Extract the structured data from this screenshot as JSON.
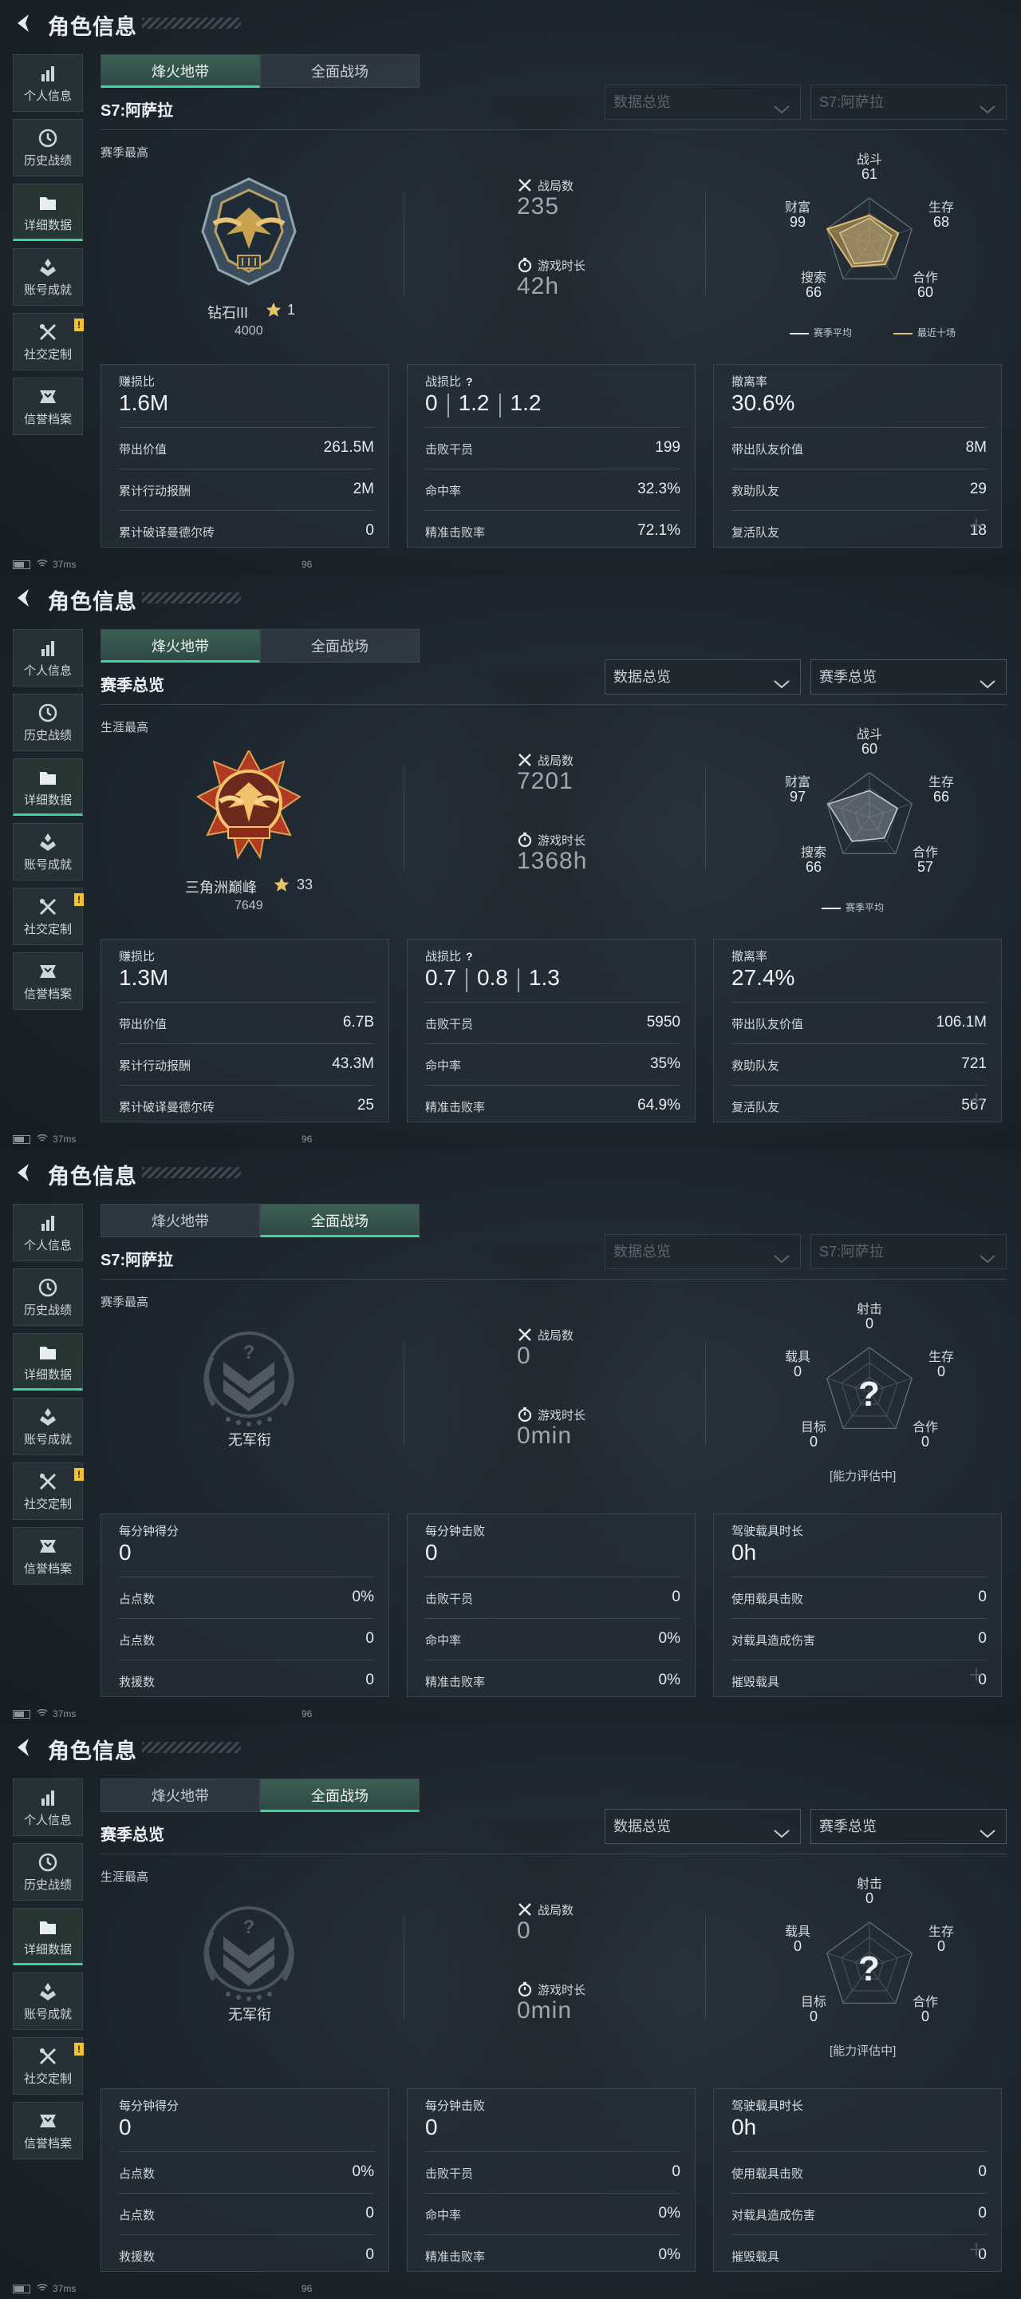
{
  "common": {
    "title": "角色信息",
    "sidebar": [
      "个人信息",
      "历史战绩",
      "详细数据",
      "账号成就",
      "社交定制",
      "信誉档案"
    ],
    "sidebar_active": 2,
    "sidebar_warn_index": 4,
    "warn_mark": "!",
    "tabs": [
      "烽火地带",
      "全面战场"
    ],
    "status_ping": "37ms",
    "status_num": "96",
    "accent": "#38d39a"
  },
  "panels": [
    {
      "active_tab": 0,
      "season": "S7:阿萨拉",
      "dropdowns": [
        {
          "label": "数据总览",
          "dim": true
        },
        {
          "label": "S7:阿萨拉",
          "dim": true
        }
      ],
      "section_label": "赛季最高",
      "rank_emblem": "diamond-emblem",
      "rank_name": "钻石III",
      "rank_level": "1",
      "rank_score": "4000",
      "stat1": {
        "label": "战局数",
        "value": "235"
      },
      "stat2": {
        "label": "游戏时长",
        "value": "42h"
      },
      "radar": {
        "type": "colored",
        "labels": [
          "战斗",
          "生存",
          "合作",
          "搜索",
          "财富"
        ],
        "values": [
          "61",
          "68",
          "60",
          "66",
          "99"
        ],
        "shape": [
          0.61,
          0.68,
          0.6,
          0.66,
          0.99
        ],
        "shape2": [
          0.55,
          0.52,
          0.5,
          0.58,
          0.7
        ],
        "legend": [
          "赛季平均",
          "最近十场"
        ],
        "placeholder": ""
      },
      "cards": [
        {
          "header": "赚损比",
          "value": "1.6M",
          "rows": [
            [
              "带出价值",
              "261.5M"
            ],
            [
              "累计行动报酬",
              "2M"
            ],
            [
              "累计破译曼德尔砖",
              "0"
            ]
          ]
        },
        {
          "header": "战损比",
          "kd": [
            "0",
            "1.2",
            "1.2"
          ],
          "q": "?",
          "rows": [
            [
              "击败干员",
              "199"
            ],
            [
              "命中率",
              "32.3%"
            ],
            [
              "精准击败率",
              "72.1%"
            ]
          ]
        },
        {
          "header": "撤离率",
          "value": "30.6%",
          "rows": [
            [
              "带出队友价值",
              "8M"
            ],
            [
              "救助队友",
              "29"
            ],
            [
              "复活队友",
              "18"
            ]
          ]
        }
      ]
    },
    {
      "active_tab": 0,
      "season": "赛季总览",
      "dropdowns": [
        {
          "label": "数据总览",
          "dim": false
        },
        {
          "label": "赛季总览",
          "dim": false
        }
      ],
      "section_label": "生涯最高",
      "rank_emblem": "peak-emblem",
      "rank_name": "三角洲巅峰",
      "rank_level": "33",
      "rank_score": "7649",
      "stat1": {
        "label": "战局数",
        "value": "7201"
      },
      "stat2": {
        "label": "游戏时长",
        "value": "1368h"
      },
      "radar": {
        "type": "gray",
        "labels": [
          "战斗",
          "生存",
          "合作",
          "搜索",
          "财富"
        ],
        "values": [
          "60",
          "66",
          "57",
          "66",
          "97"
        ],
        "shape": [
          0.6,
          0.66,
          0.57,
          0.66,
          0.97
        ],
        "legend": [
          "赛季平均"
        ],
        "placeholder": ""
      },
      "cards": [
        {
          "header": "赚损比",
          "value": "1.3M",
          "rows": [
            [
              "带出价值",
              "6.7B"
            ],
            [
              "累计行动报酬",
              "43.3M"
            ],
            [
              "累计破译曼德尔砖",
              "25"
            ]
          ]
        },
        {
          "header": "战损比",
          "kd": [
            "0.7",
            "0.8",
            "1.3"
          ],
          "q": "?",
          "rows": [
            [
              "击败干员",
              "5950"
            ],
            [
              "命中率",
              "35%"
            ],
            [
              "精准击败率",
              "64.9%"
            ]
          ]
        },
        {
          "header": "撤离率",
          "value": "27.4%",
          "rows": [
            [
              "带出队友价值",
              "106.1M"
            ],
            [
              "救助队友",
              "721"
            ],
            [
              "复活队友",
              "567"
            ]
          ]
        }
      ]
    },
    {
      "active_tab": 1,
      "season": "S7:阿萨拉",
      "dropdowns": [
        {
          "label": "数据总览",
          "dim": true
        },
        {
          "label": "S7:阿萨拉",
          "dim": true
        }
      ],
      "section_label": "赛季最高",
      "rank_emblem": "no-rank-emblem",
      "rank_name": "无军衔",
      "rank_level": "",
      "rank_score": "",
      "stat1": {
        "label": "战局数",
        "value": "0"
      },
      "stat2": {
        "label": "游戏时长",
        "value": "0min"
      },
      "radar": {
        "type": "empty",
        "labels": [
          "射击",
          "生存",
          "合作",
          "目标",
          "载具"
        ],
        "values": [
          "0",
          "0",
          "0",
          "0",
          "0"
        ],
        "legend": [],
        "placeholder": "[能力评估中]",
        "qmark": "?"
      },
      "cards": [
        {
          "header": "每分钟得分",
          "value": "0",
          "rows": [
            [
              "占点数",
              "0%"
            ],
            [
              "占点数",
              "0"
            ],
            [
              "救援数",
              "0"
            ]
          ]
        },
        {
          "header": "每分钟击败",
          "value": "0",
          "rows": [
            [
              "击败干员",
              "0"
            ],
            [
              "命中率",
              "0%"
            ],
            [
              "精准击败率",
              "0%"
            ]
          ]
        },
        {
          "header": "驾驶载具时长",
          "value": "0h",
          "rows": [
            [
              "使用载具击败",
              "0"
            ],
            [
              "对载具造成伤害",
              "0"
            ],
            [
              "摧毁载具",
              "0"
            ]
          ]
        }
      ]
    },
    {
      "active_tab": 1,
      "season": "赛季总览",
      "dropdowns": [
        {
          "label": "数据总览",
          "dim": false
        },
        {
          "label": "赛季总览",
          "dim": false
        }
      ],
      "section_label": "生涯最高",
      "rank_emblem": "no-rank-emblem",
      "rank_name": "无军衔",
      "rank_level": "",
      "rank_score": "",
      "stat1": {
        "label": "战局数",
        "value": "0"
      },
      "stat2": {
        "label": "游戏时长",
        "value": "0min"
      },
      "radar": {
        "type": "empty",
        "labels": [
          "射击",
          "生存",
          "合作",
          "目标",
          "载具"
        ],
        "values": [
          "0",
          "0",
          "0",
          "0",
          "0"
        ],
        "legend": [],
        "placeholder": "[能力评估中]",
        "qmark": "?"
      },
      "cards": [
        {
          "header": "每分钟得分",
          "value": "0",
          "rows": [
            [
              "占点数",
              "0%"
            ],
            [
              "占点数",
              "0"
            ],
            [
              "救援数",
              "0"
            ]
          ]
        },
        {
          "header": "每分钟击败",
          "value": "0",
          "rows": [
            [
              "击败干员",
              "0"
            ],
            [
              "命中率",
              "0%"
            ],
            [
              "精准击败率",
              "0%"
            ]
          ]
        },
        {
          "header": "驾驶载具时长",
          "value": "0h",
          "rows": [
            [
              "使用载具击败",
              "0"
            ],
            [
              "对载具造成伤害",
              "0"
            ],
            [
              "摧毁载具",
              "0"
            ]
          ]
        }
      ]
    }
  ]
}
